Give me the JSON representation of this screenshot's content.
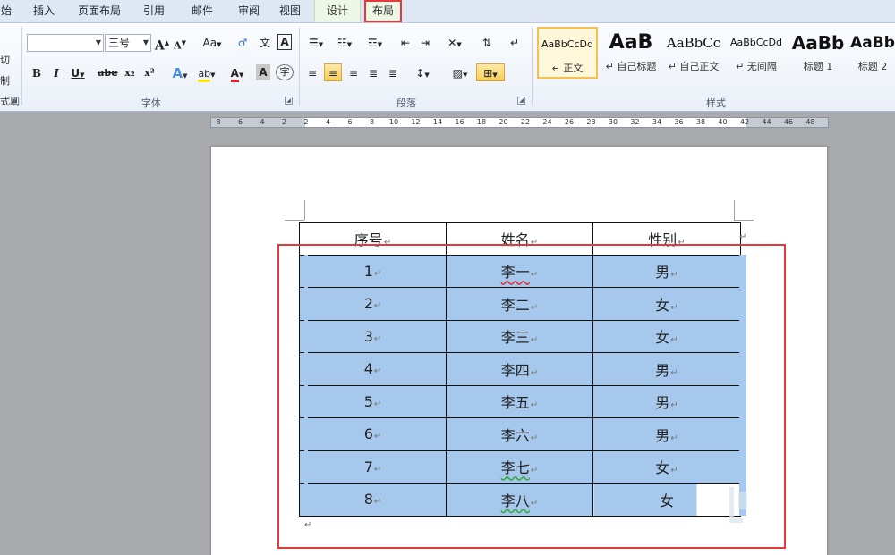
{
  "tabs": [
    {
      "key": "start",
      "label": "始"
    },
    {
      "key": "insert",
      "label": "插入"
    },
    {
      "key": "page_layout",
      "label": "页面布局"
    },
    {
      "key": "references",
      "label": "引用"
    },
    {
      "key": "mailings",
      "label": "邮件"
    },
    {
      "key": "review",
      "label": "审阅"
    },
    {
      "key": "view",
      "label": "视图"
    },
    {
      "key": "design",
      "label": "设计"
    },
    {
      "key": "layout",
      "label": "布局"
    }
  ],
  "left_strip": [
    "切",
    "制",
    "式刷"
  ],
  "font_group": {
    "label": "字体",
    "font_name": "",
    "font_size": "三号",
    "grow_font": "A",
    "shrink_font": "A",
    "change_case": "Aa",
    "phonetic": "文",
    "char_border": "A",
    "bold": "B",
    "italic": "I",
    "underline": "U",
    "strike": "abe",
    "subscript": "x₂",
    "superscript": "x²",
    "text_effect": "A",
    "highlight": "ab",
    "font_color": "A",
    "char_shading": "A",
    "enclose": "字"
  },
  "paragraph_group": {
    "label": "段落"
  },
  "styles_group": {
    "label": "样式",
    "items": [
      {
        "preview": "AaBbCcDd",
        "name": "正文"
      },
      {
        "preview": "AaB",
        "name": "自己标题"
      },
      {
        "preview": "AaBbCc",
        "name": "自己正文"
      },
      {
        "preview": "AaBbCcDd",
        "name": "无间隔"
      },
      {
        "preview": "AaBb",
        "name": "标题 1"
      },
      {
        "preview": "AaBb",
        "name": "标题 2"
      }
    ]
  },
  "ruler_numbers": [
    "8",
    "6",
    "4",
    "2",
    "2",
    "4",
    "6",
    "8",
    "10",
    "12",
    "14",
    "16",
    "18",
    "20",
    "22",
    "24",
    "26",
    "28",
    "30",
    "32",
    "34",
    "36",
    "38",
    "40",
    "42",
    "44",
    "46",
    "48"
  ],
  "table": {
    "headers": [
      "序号",
      "姓名",
      "性别"
    ],
    "rows": [
      [
        "1",
        "李一",
        "男"
      ],
      [
        "2",
        "李二",
        "女"
      ],
      [
        "3",
        "李三",
        "女"
      ],
      [
        "4",
        "李四",
        "男"
      ],
      [
        "5",
        "李五",
        "男"
      ],
      [
        "6",
        "李六",
        "男"
      ],
      [
        "7",
        "李七",
        "女"
      ],
      [
        "8",
        "李八",
        "女"
      ]
    ]
  },
  "mark_char": "↵",
  "colors": {
    "selection": "#a6c8ec",
    "annotation_red": "#e23a3a",
    "ribbon_bg": "#eaf0f8"
  }
}
